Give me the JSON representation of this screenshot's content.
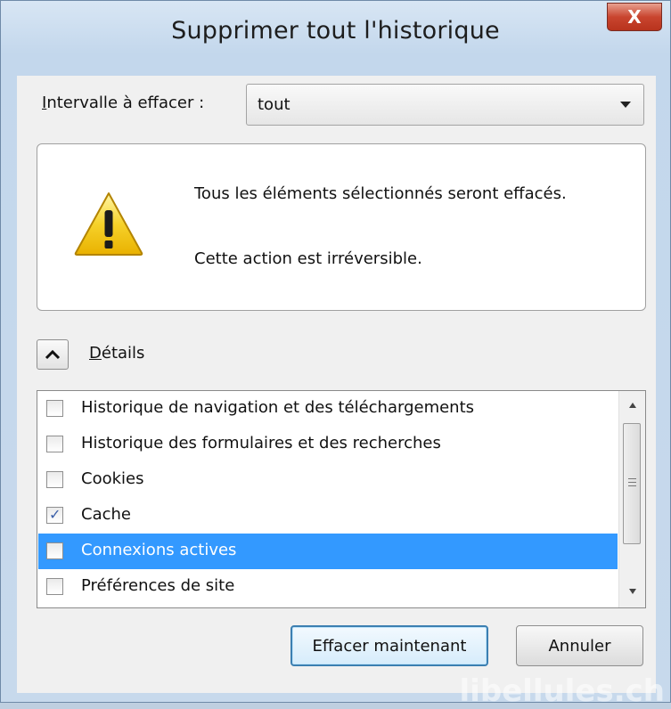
{
  "window": {
    "title": "Supprimer tout l'historique",
    "close_label": "X"
  },
  "interval": {
    "label_prefix": "I",
    "label_rest": "ntervalle à effacer :",
    "selected_value": "tout"
  },
  "warning": {
    "line1": "Tous les éléments sélectionnés seront effacés.",
    "line2": "Cette action est irréversible."
  },
  "details": {
    "label_prefix": "D",
    "label_rest": "étails",
    "expanded": true
  },
  "items": [
    {
      "label": "Historique de navigation et des téléchargements",
      "checked": false,
      "selected": false
    },
    {
      "label": "Historique des formulaires et des recherches",
      "checked": false,
      "selected": false
    },
    {
      "label": "Cookies",
      "checked": false,
      "selected": false
    },
    {
      "label": "Cache",
      "checked": true,
      "selected": false
    },
    {
      "label": "Connexions actives",
      "checked": false,
      "selected": true
    },
    {
      "label": "Préférences de site",
      "checked": false,
      "selected": false
    }
  ],
  "buttons": {
    "clear_now": "Effacer maintenant",
    "cancel": "Annuler"
  },
  "watermark": "libellules.ch",
  "icons": {
    "warning": "warning-triangle-icon",
    "collapse": "chevron-up-icon",
    "dropdown": "dropdown-arrow-icon"
  },
  "colors": {
    "selection": "#3399ff",
    "close_button": "#c9452f",
    "warning_yellow": "#f2c200"
  }
}
